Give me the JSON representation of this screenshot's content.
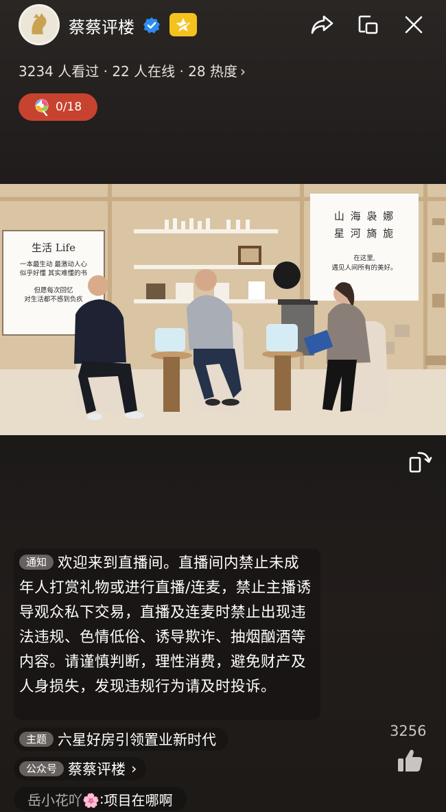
{
  "header": {
    "host_name": "蔡蔡评楼",
    "verified_icon": "verified-check-icon",
    "badge_icon": "star-badge-icon",
    "share_icon": "share-icon",
    "float_window_icon": "float-window-icon",
    "close_icon": "close-icon"
  },
  "stats": {
    "text": "3234 人看过 · 22 人在线 · 28 热度",
    "chevron": "›"
  },
  "gift": {
    "icon": "lollipop-icon",
    "count": "0/18"
  },
  "video": {
    "left_board": {
      "title": "生活 Life",
      "line1": "一本最生动 最激动人心",
      "line2": "似乎好懂 其实难懂的书",
      "line3": "但愿每次回忆",
      "line4": "对生活都不感到负疚"
    },
    "right_board": {
      "title_line1": "山 海 袅 娜",
      "title_line2": "星 河 旖 旎",
      "line1": "在这里,",
      "line2": "遇见人间所有的美好。"
    }
  },
  "rotate_icon": "rotate-screen-icon",
  "notice": {
    "tag": "通知",
    "text": "欢迎来到直播间。直播间内禁止未成年人打赏礼物或进行直播/连麦，禁止主播诱导观众私下交易，直播及连麦时禁止出现违法违规、色情低俗、诱导欺诈、抽烟酗酒等内容。请谨慎判断，理性消费，避免财产及人身损失，发现违规行为请及时投诉。"
  },
  "topic": {
    "tag": "主题",
    "text": "六星好房引领置业新时代"
  },
  "account": {
    "tag": "公众号",
    "name": "蔡蔡评楼",
    "chevron": "›"
  },
  "comment": {
    "user": "岳小花吖🌸",
    "separator": ":",
    "text": "项目在哪啊"
  },
  "likes": {
    "count": "3256",
    "icon": "thumbs-up-icon"
  },
  "colors": {
    "badge_yellow": "#f3c21d",
    "gift_pill": "#c8432f",
    "verified_blue": "#2d8cf0",
    "tag_bg": "#66615e"
  }
}
